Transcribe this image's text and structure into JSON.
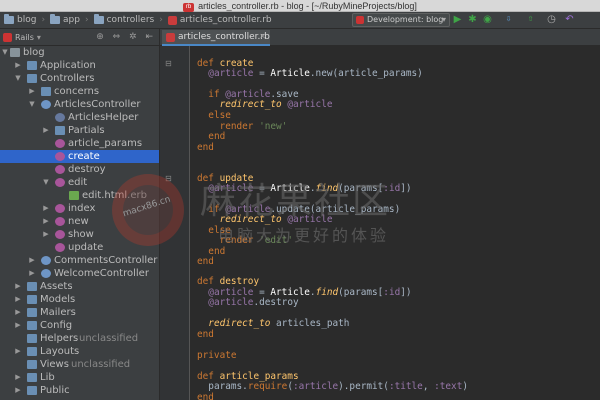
{
  "window": {
    "title": "articles_controller.rb - blog - [~/RubyMineProjects/blog]"
  },
  "navbar": {
    "crumbs": [
      "blog",
      "app",
      "controllers",
      "articles_controller.rb"
    ],
    "run_config": "Development: blog"
  },
  "colors": {
    "selection": "#2f65ca",
    "accent_tab": "#4a88c7",
    "ruby_red": "#c93c3c",
    "run_green": "#3fa447"
  },
  "sidebar": {
    "header": "Rails",
    "tree": [
      {
        "label": "blog"
      },
      {
        "label": "Application"
      },
      {
        "label": "Controllers"
      },
      {
        "label": "concerns"
      },
      {
        "label": "ArticlesController"
      },
      {
        "label": "ArticlesHelper"
      },
      {
        "label": "Partials"
      },
      {
        "label": "article_params"
      },
      {
        "label": "create"
      },
      {
        "label": "destroy"
      },
      {
        "label": "edit"
      },
      {
        "label": "edit.html.erb"
      },
      {
        "label": "index"
      },
      {
        "label": "new"
      },
      {
        "label": "show"
      },
      {
        "label": "update"
      },
      {
        "label": "CommentsController"
      },
      {
        "label": "WelcomeController"
      },
      {
        "label": "Assets"
      },
      {
        "label": "Models"
      },
      {
        "label": "Mailers"
      },
      {
        "label": "Config"
      },
      {
        "label": "Helpers",
        "note": "unclassified"
      },
      {
        "label": "Layouts"
      },
      {
        "label": "Views",
        "note": "unclassified"
      },
      {
        "label": "Lib"
      },
      {
        "label": "Public"
      }
    ]
  },
  "editor": {
    "tab": "articles_controller.rb",
    "lines": [
      "def create",
      "@article = Article.new(article_params)",
      "",
      "if @article.save",
      "redirect_to @article",
      "else",
      "render 'new'",
      "end",
      "end",
      "",
      "def update",
      "@article = Article.find(params[:id])",
      "",
      "if @article.update(article_params)",
      "redirect_to @article",
      "else",
      "render 'edit'",
      "end",
      "end",
      "",
      "def destroy",
      "@article = Article.find(params[:id])",
      "@article.destroy",
      "",
      "redirect_to articles_path",
      "end",
      "",
      "private",
      "",
      "def article_params",
      "params.require(:article).permit(:title, :text)",
      "end"
    ]
  },
  "watermark": {
    "title": "麻花果社区",
    "slogan": "电脑大为更好的体验",
    "site": "macx86.cn"
  }
}
